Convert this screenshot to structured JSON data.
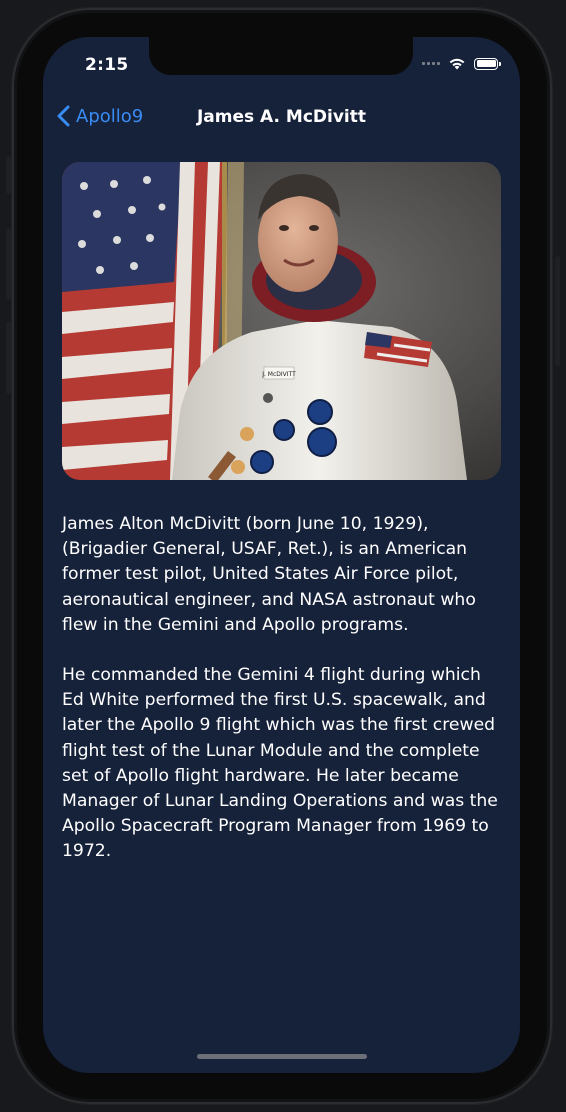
{
  "status_bar": {
    "time": "2:15"
  },
  "nav": {
    "back_label": "Apollo9",
    "title": "James A. McDivitt"
  },
  "photo": {
    "name_tag": "J. McDIVITT"
  },
  "bio": {
    "paragraphs": [
      "James Alton McDivitt (born June 10, 1929), (Brigadier General, USAF, Ret.), is an American former test pilot, United States Air Force pilot, aeronautical engineer, and NASA astronaut who flew in the Gemini and Apollo programs.",
      "He commanded the Gemini 4 flight during which Ed White performed the first U.S. spacewalk, and later the Apollo 9 flight which was the first crewed flight test of the Lunar Module and the complete set of Apollo flight hardware. He later became Manager of Lunar Landing Operations and was the Apollo Spacecraft Program Manager from 1969 to 1972."
    ]
  },
  "colors": {
    "background": "#16213a",
    "accent": "#3a8cf5",
    "text": "#ffffff"
  },
  "icons": {
    "back": "chevron-left-icon",
    "signal": "cellular-signal-icon",
    "wifi": "wifi-icon",
    "battery": "battery-icon"
  }
}
